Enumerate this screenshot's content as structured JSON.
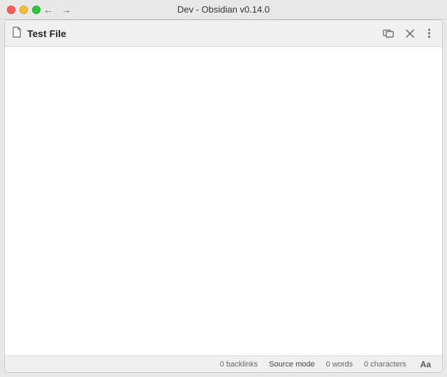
{
  "titleBar": {
    "title": "Dev - Obsidian v0.14.0",
    "backBtn": "←",
    "forwardBtn": "→"
  },
  "toolbar": {
    "fileIcon": "🗋",
    "fileTitle": "Test File",
    "linkBtnTitle": "Open linked files",
    "closeBtnTitle": "Close",
    "menuBtnTitle": "More options"
  },
  "statusBar": {
    "backlinks": "0 backlinks",
    "sourceMode": "Source mode",
    "words": "0 words",
    "characters": "0 characters",
    "fontBtn": "Aa"
  }
}
